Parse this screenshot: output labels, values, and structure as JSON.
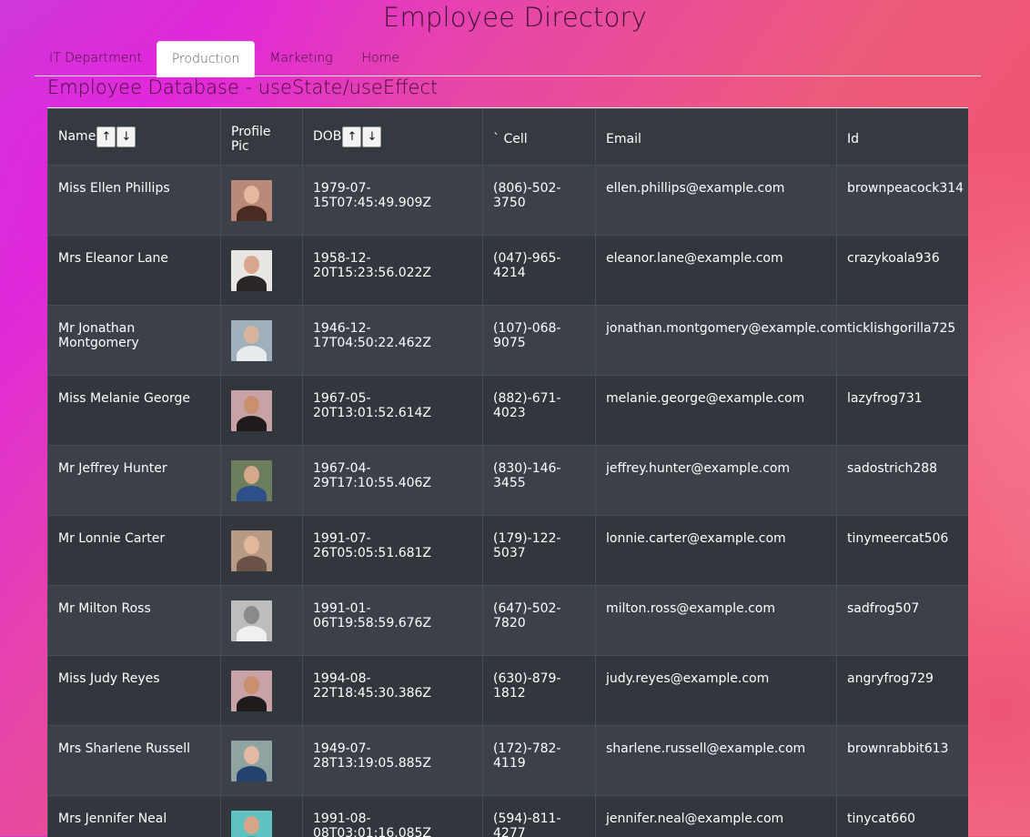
{
  "title": "Employee Directory",
  "tabs": [
    {
      "label": "IT Department",
      "active": false
    },
    {
      "label": "Production",
      "active": true
    },
    {
      "label": "Marketing",
      "active": false
    },
    {
      "label": "Home",
      "active": false
    }
  ],
  "subtitle": "Employee Database - useState/useEffect",
  "table": {
    "headers": {
      "name": "Name",
      "sort_up": "↑",
      "sort_down": "↓",
      "profile_pic": "Profile Pic",
      "dob": "DOB",
      "cell": "` Cell",
      "email": "Email",
      "id": "Id"
    },
    "rows": [
      {
        "name": "Miss Ellen Phillips",
        "dob": "1979-07-15T07:45:49.909Z",
        "cell": "(806)-502-3750",
        "email": "ellen.phillips@example.com",
        "id": "brownpeacock314",
        "avatar": {
          "bg": "#b98a7a",
          "head": "#e6b8a0",
          "body": "#4a2b22"
        }
      },
      {
        "name": "Mrs Eleanor Lane",
        "dob": "1958-12-20T15:23:56.022Z",
        "cell": "(047)-965-4214",
        "email": "eleanor.lane@example.com",
        "id": "crazykoala936",
        "avatar": {
          "bg": "#e8e6e2",
          "head": "#d9a58c",
          "body": "#2a2628"
        }
      },
      {
        "name": "Mr Jonathan Montgomery",
        "dob": "1946-12-17T04:50:22.462Z",
        "cell": "(107)-068-9075",
        "email": "jonathan.montgomery@example.com",
        "id": "ticklishgorilla725",
        "avatar": {
          "bg": "#9fb0ba",
          "head": "#d8b49c",
          "body": "#e9ecef"
        }
      },
      {
        "name": "Miss Melanie George",
        "dob": "1967-05-20T13:01:52.614Z",
        "cell": "(882)-671-4023",
        "email": "melanie.george@example.com",
        "id": "lazyfrog731",
        "avatar": {
          "bg": "#c9a2a8",
          "head": "#c99070",
          "body": "#1f1a1c"
        }
      },
      {
        "name": "Mr Jeffrey Hunter",
        "dob": "1967-04-29T17:10:55.406Z",
        "cell": "(830)-146-3455",
        "email": "jeffrey.hunter@example.com",
        "id": "sadostrich288",
        "avatar": {
          "bg": "#6d7e5e",
          "head": "#d6a98a",
          "body": "#2d4f8a"
        }
      },
      {
        "name": "Mr Lonnie Carter",
        "dob": "1991-07-26T05:05:51.681Z",
        "cell": "(179)-122-5037",
        "email": "lonnie.carter@example.com",
        "id": "tinymeercat506",
        "avatar": {
          "bg": "#b79a86",
          "head": "#e2b89a",
          "body": "#6b5246"
        }
      },
      {
        "name": "Mr Milton Ross",
        "dob": "1991-01-06T19:58:59.676Z",
        "cell": "(647)-502-7820",
        "email": "milton.ross@example.com",
        "id": "sadfrog507",
        "avatar": {
          "bg": "#bdbdbd",
          "head": "#8a8a8a",
          "body": "#f0f0f0"
        }
      },
      {
        "name": "Miss Judy Reyes",
        "dob": "1994-08-22T18:45:30.386Z",
        "cell": "(630)-879-1812",
        "email": "judy.reyes@example.com",
        "id": "angryfrog729",
        "avatar": {
          "bg": "#c9a2a8",
          "head": "#c99070",
          "body": "#1f1a1c"
        }
      },
      {
        "name": "Mrs Sharlene Russell",
        "dob": "1949-07-28T13:19:05.885Z",
        "cell": "(172)-782-4119",
        "email": "sharlene.russell@example.com",
        "id": "brownrabbit613",
        "avatar": {
          "bg": "#8fa3a0",
          "head": "#e3b9a2",
          "body": "#24426e"
        }
      },
      {
        "name": "Mrs Jennifer Neal",
        "dob": "1991-08-08T03:01:16.085Z",
        "cell": "(594)-811-4277",
        "email": "jennifer.neal@example.com",
        "id": "tinycat660",
        "avatar": {
          "bg": "#5ec2c0",
          "head": "#d8a488",
          "body": "#3aa8a8"
        }
      }
    ]
  }
}
